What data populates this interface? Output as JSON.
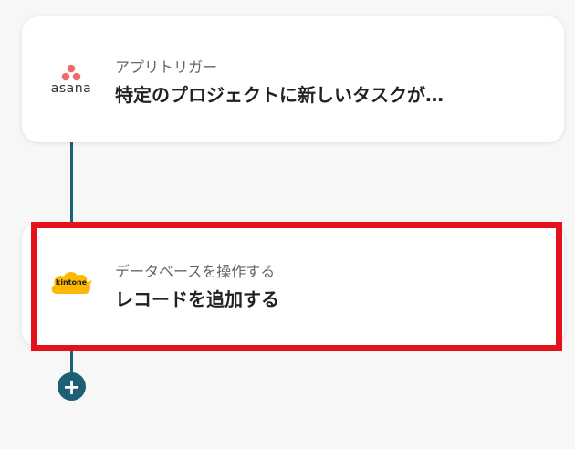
{
  "steps": [
    {
      "app_logo": "asana",
      "logo_word": "asana",
      "subtitle": "アプリトリガー",
      "title": "特定のプロジェクトに新しいタスクが…"
    },
    {
      "app_logo": "kintone",
      "logo_word": "kintone",
      "subtitle": "データベースを操作する",
      "title": "レコードを追加する"
    }
  ],
  "add_button": {
    "label": "+"
  },
  "colors": {
    "connector": "#1d5f74",
    "highlight": "#e4121a",
    "asana": "#f06a6a",
    "kintone": "#fcb900"
  },
  "icons": [
    "asana-logo-icon",
    "kintone-logo-icon",
    "plus-icon"
  ]
}
